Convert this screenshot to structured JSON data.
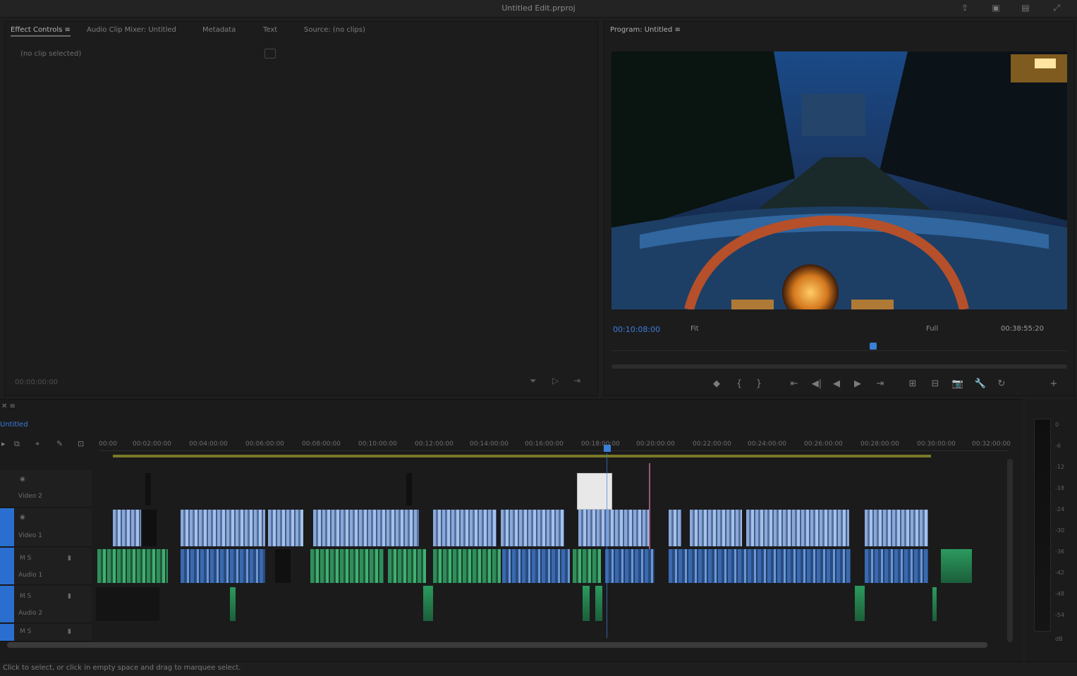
{
  "app": {
    "title": "Untitled Edit.prproj"
  },
  "window_controls": [
    {
      "name": "share-icon",
      "glyph": "⇪"
    },
    {
      "name": "workspace-icon",
      "glyph": "▣"
    },
    {
      "name": "panel-icon",
      "glyph": "▤"
    },
    {
      "name": "fullscreen-icon",
      "glyph": "⤢"
    }
  ],
  "left_panel": {
    "tabs": [
      {
        "label": "Effect Controls ≡",
        "active": true
      },
      {
        "label": "Audio Clip Mixer: Untitled",
        "active": false
      },
      {
        "label": "Metadata",
        "active": false
      },
      {
        "label": "Text",
        "active": false
      },
      {
        "label": "Source: (no clips)",
        "active": false
      }
    ],
    "empty_message": "(no clip selected)",
    "footer_time": "00:00:00:00"
  },
  "program": {
    "tab_label": "Program: Untitled ≡",
    "timecode": "00:10:08:00",
    "fit": "Fit",
    "resolution": "Full",
    "duration": "00:38:55:20"
  },
  "transport": [
    "◆",
    "{",
    "}",
    "⇤",
    "◀|",
    "◀",
    "▶",
    "|▶",
    "⇥",
    "⊞",
    "⊟",
    "📷",
    "🔧",
    "↻",
    "+"
  ],
  "timeline": {
    "sequence_label": "Untitled",
    "ruler": [
      "00:00",
      "00:02:00:00",
      "00:04:00:00",
      "00:06:00:00",
      "00:08:00:00",
      "00:10:00:00",
      "00:12:00:00",
      "00:14:00:00",
      "00:16:00:00",
      "00:18:00:00",
      "00:20:00:00",
      "00:22:00:00",
      "00:24:00:00",
      "00:26:00:00",
      "00:28:00:00",
      "00:30:00:00",
      "00:32:00:00"
    ],
    "tracks": [
      {
        "name": "Video 2",
        "kind": "video"
      },
      {
        "name": "Video 1",
        "kind": "video"
      },
      {
        "name": "Audio 1",
        "kind": "audio"
      },
      {
        "name": "Audio 2",
        "kind": "audio"
      },
      {
        "name": "",
        "kind": "audio"
      }
    ],
    "tools": [
      "▸",
      "⧉",
      "⌖",
      "✎",
      "⊡"
    ]
  },
  "meter": {
    "ticks": [
      "0",
      "-6",
      "-12",
      "-18",
      "-24",
      "-30",
      "-36",
      "-42",
      "-48",
      "-54",
      "dB"
    ]
  },
  "status": {
    "text": "Click to select, or click in empty space and drag to marquee select."
  }
}
